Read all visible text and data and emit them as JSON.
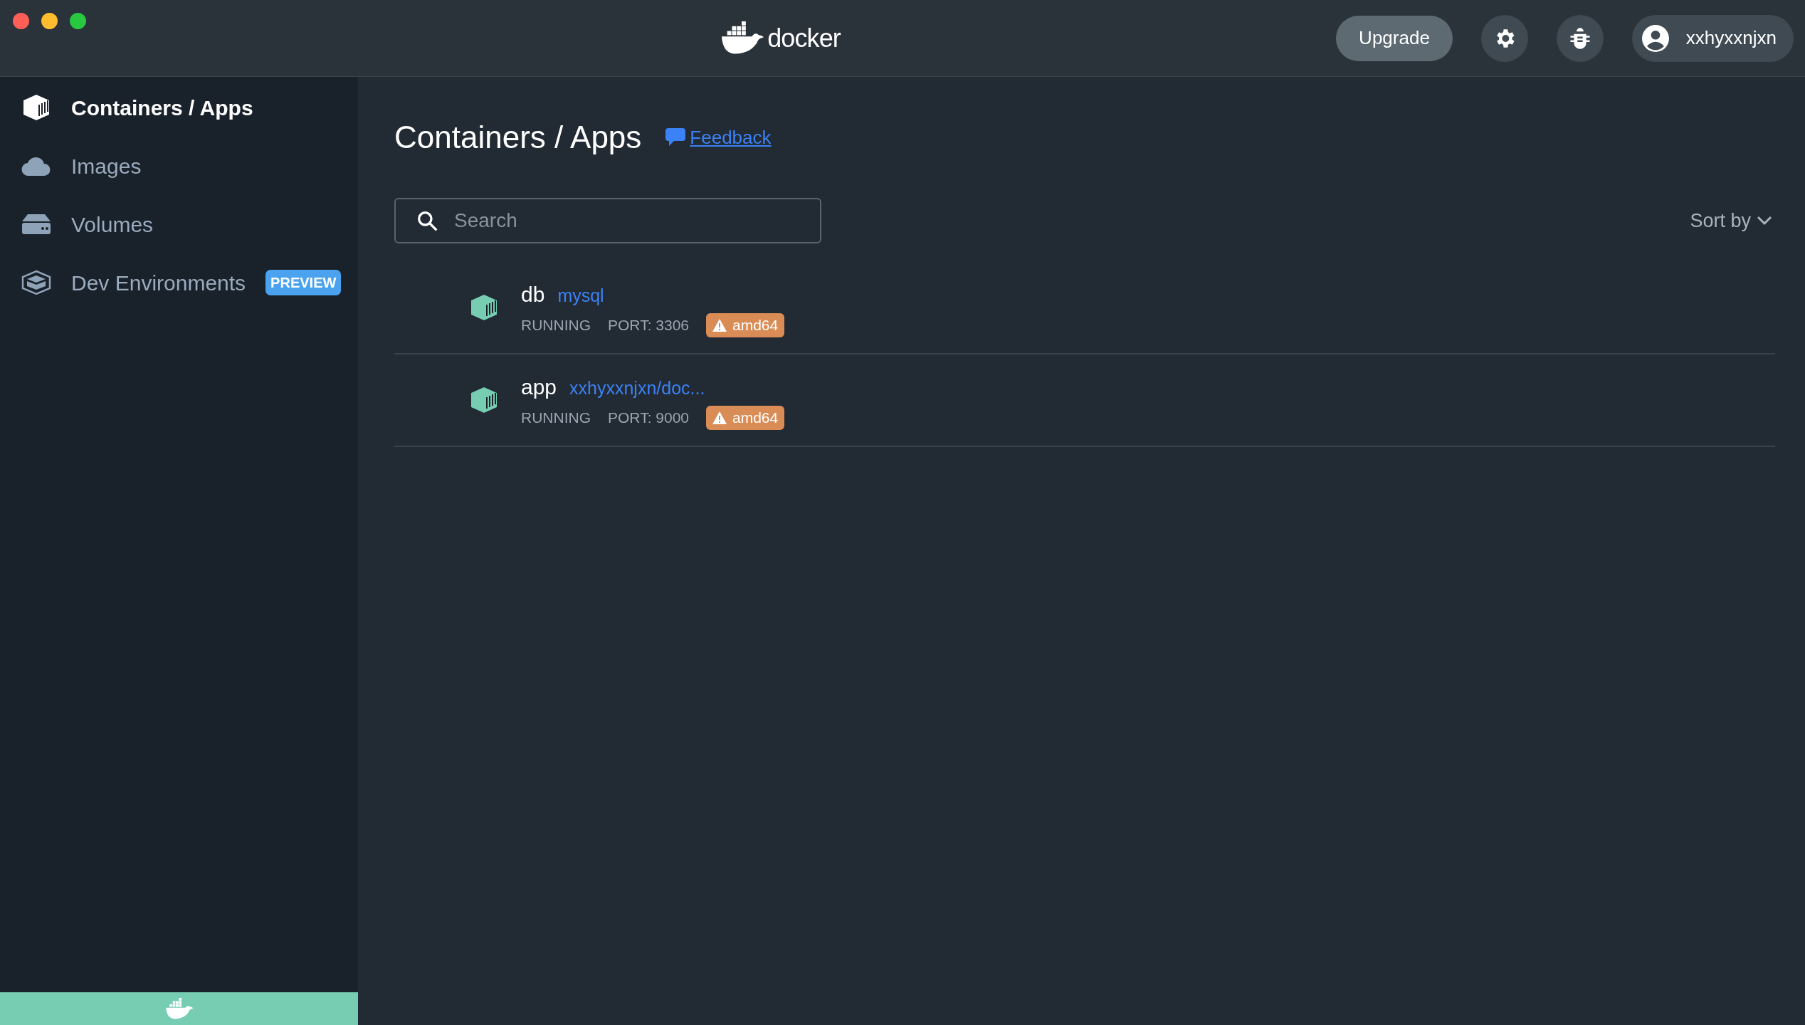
{
  "titlebar": {
    "logo_text": "docker",
    "upgrade_button": "Upgrade",
    "account": "xxhyxxnjxn"
  },
  "sidebar": {
    "items": [
      {
        "label": "Containers / Apps",
        "kind": "containers",
        "selected": true
      },
      {
        "label": "Images",
        "kind": "images",
        "selected": false
      },
      {
        "label": "Volumes",
        "kind": "volumes",
        "selected": false
      },
      {
        "label": "Dev Environments",
        "kind": "dev",
        "selected": false,
        "badge": "PREVIEW"
      }
    ]
  },
  "main": {
    "title": "Containers / Apps",
    "feedback_link": "Feedback",
    "search": {
      "placeholder": "Search"
    },
    "sort_label": "Sort by",
    "containers": [
      {
        "name": "db",
        "image": "mysql",
        "status": "RUNNING",
        "port": "PORT: 3306",
        "arch": "amd64"
      },
      {
        "name": "app",
        "image": "xxhyxxnjxn/doc...",
        "status": "RUNNING",
        "port": "PORT: 9000",
        "arch": "amd64"
      }
    ]
  }
}
